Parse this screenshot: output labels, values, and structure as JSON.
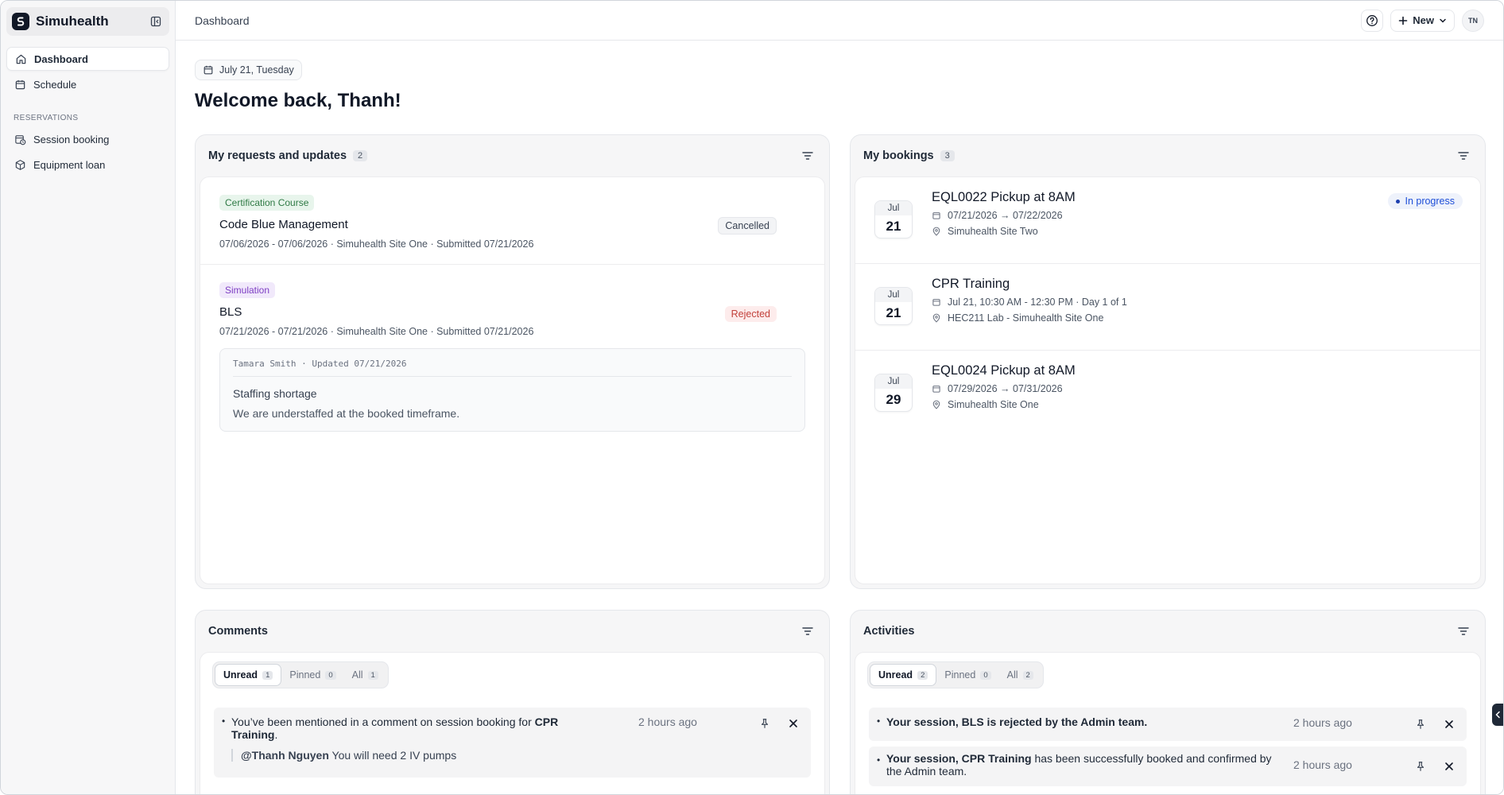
{
  "app": {
    "name": "Simuhealth"
  },
  "sidebar": {
    "items": [
      {
        "label": "Dashboard",
        "icon": "home-icon",
        "active": true
      },
      {
        "label": "Schedule",
        "icon": "calendar-icon"
      }
    ],
    "section_label": "RESERVATIONS",
    "reservation_items": [
      {
        "label": "Session booking",
        "icon": "calendar-clock-icon"
      },
      {
        "label": "Equipment loan",
        "icon": "package-icon"
      }
    ]
  },
  "header": {
    "title": "Dashboard",
    "new_label": "New",
    "avatar_initials": "TN"
  },
  "date_label": "July 21, Tuesday",
  "welcome": "Welcome back, Thanh!",
  "requests": {
    "title": "My requests and updates",
    "count": "2",
    "items": [
      {
        "tag": "Certification Course",
        "title": "Code Blue Management",
        "meta": "07/06/2026 - 07/06/2026 · Simuhealth Site One · Submitted 07/21/2026",
        "status": "Cancelled"
      },
      {
        "tag": "Simulation",
        "title": "BLS",
        "meta": "07/21/2026 - 07/21/2026 · Simuhealth Site One · Submitted 07/21/2026",
        "status": "Rejected",
        "note": {
          "header": "Tamara Smith · Updated 07/21/2026",
          "title": "Staffing shortage",
          "text": "We are understaffed at the booked timeframe."
        }
      }
    ]
  },
  "bookings": {
    "title": "My bookings",
    "count": "3",
    "items": [
      {
        "month": "Jul",
        "day": "21",
        "title": "EQL0022 Pickup at 8AM",
        "when": "07/21/2026 → 07/22/2026",
        "where": "Simuhealth Site Two",
        "status": "In progress"
      },
      {
        "month": "Jul",
        "day": "21",
        "title": "CPR Training",
        "when": "Jul 21, 10:30 AM - 12:30 PM · Day 1 of 1",
        "where": "HEC211 Lab - Simuhealth Site One"
      },
      {
        "month": "Jul",
        "day": "29",
        "title": "EQL0024 Pickup at 8AM",
        "when": "07/29/2026 → 07/31/2026",
        "where": "Simuhealth Site One"
      }
    ]
  },
  "comments": {
    "title": "Comments",
    "tabs": [
      {
        "label": "Unread",
        "count": "1"
      },
      {
        "label": "Pinned",
        "count": "0"
      },
      {
        "label": "All",
        "count": "1"
      }
    ],
    "items": [
      {
        "text_a": "You’ve been mentioned in a comment on session booking for ",
        "text_b": "CPR Training",
        "text_c": ".",
        "time": "2 hours ago",
        "quote_user": "@Thanh Nguyen",
        "quote_text": " You will need 2 IV pumps"
      }
    ]
  },
  "activities": {
    "title": "Activities",
    "tabs": [
      {
        "label": "Unread",
        "count": "2"
      },
      {
        "label": "Pinned",
        "count": "0"
      },
      {
        "label": "All",
        "count": "2"
      }
    ],
    "items": [
      {
        "text_a": "Your session, ",
        "text_b": "BLS",
        "text_c": " is rejected by the Admin team.",
        "time": "2 hours ago"
      },
      {
        "text_a": "Your session, ",
        "text_b": "CPR Training",
        "text_c": " has been successfully booked and confirmed by the Admin team.",
        "time": "2 hours ago"
      }
    ]
  }
}
